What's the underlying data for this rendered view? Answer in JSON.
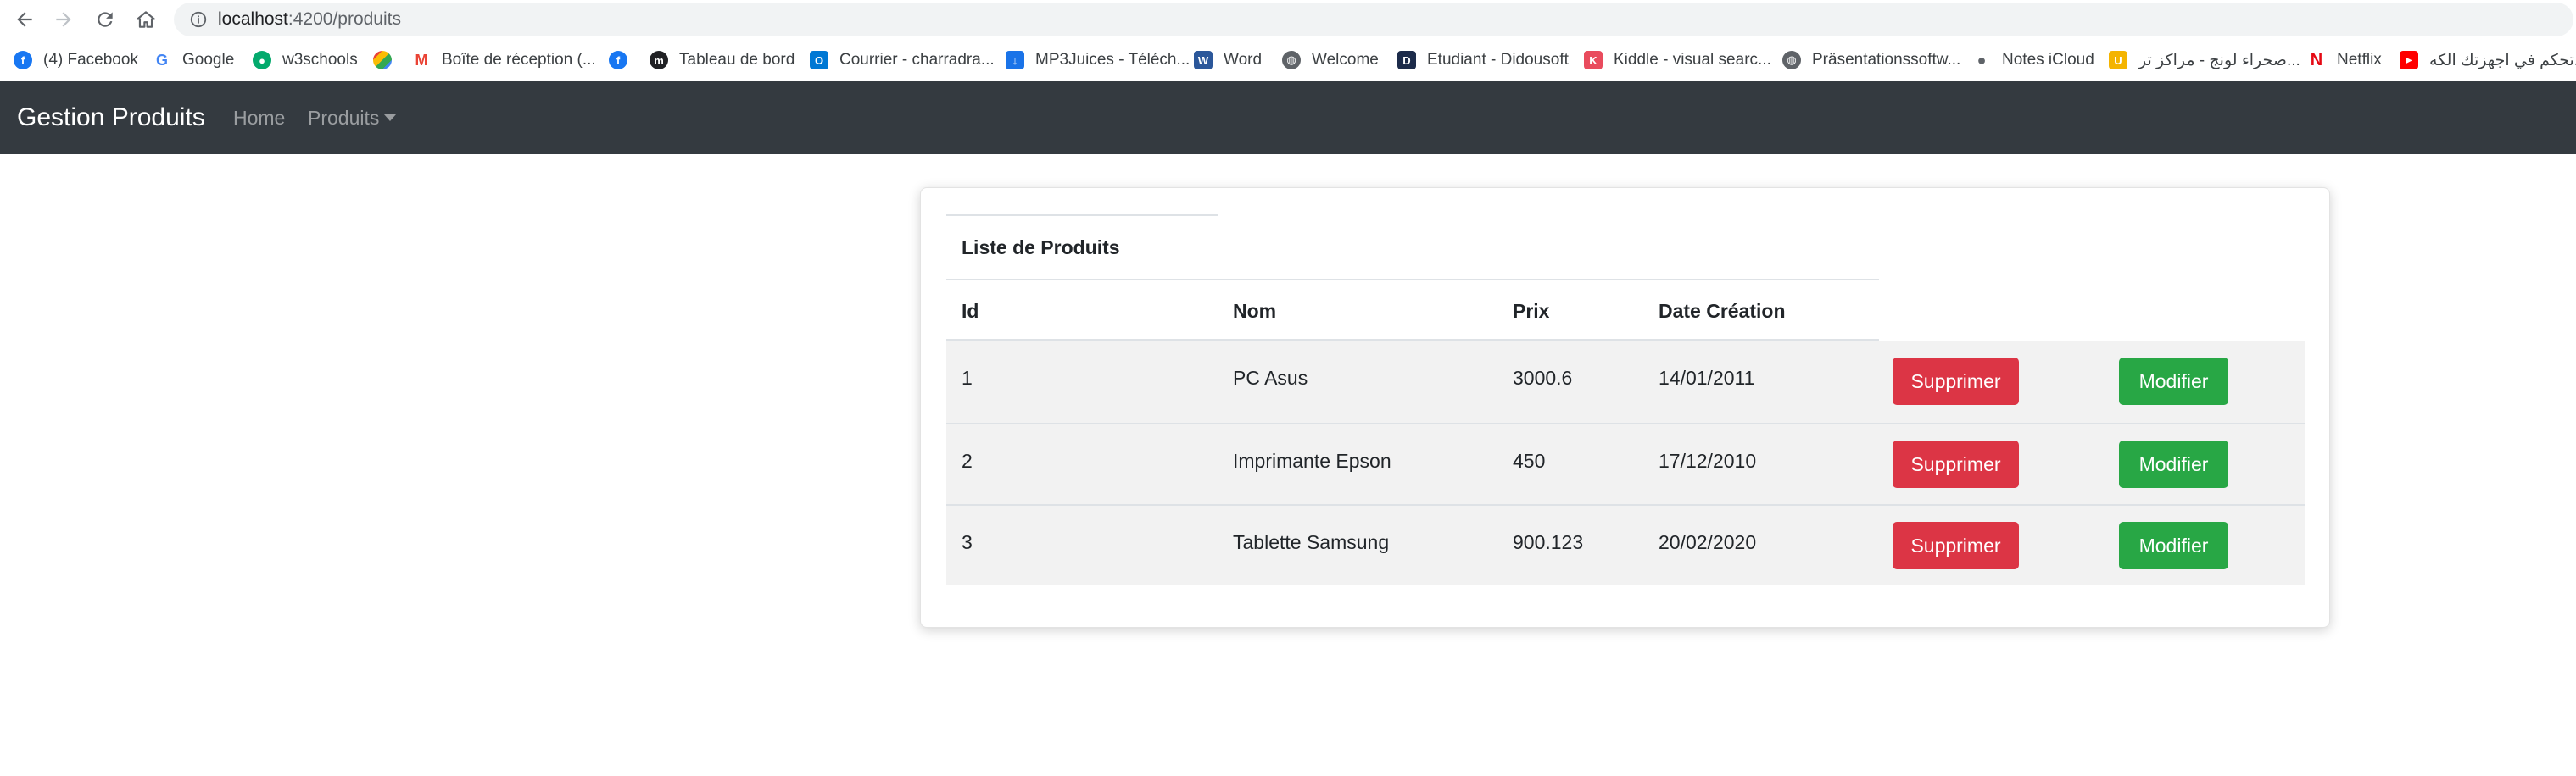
{
  "browser": {
    "url_host": "localhost",
    "url_path": ":4200/produits",
    "bookmarks": [
      {
        "label": "(4) Facebook",
        "icon": "facebook-icon",
        "color": "#1877f2"
      },
      {
        "label": "Google",
        "icon": "google-icon",
        "color": "#4285f4"
      },
      {
        "label": "w3schools",
        "icon": "w3schools-icon",
        "color": "#04aa6d"
      },
      {
        "label": "",
        "icon": "google-photos-icon",
        "color": "#fbbc04"
      },
      {
        "label": "Boîte de réception (...",
        "icon": "gmail-icon",
        "color": "#ea4335"
      },
      {
        "label": "",
        "icon": "facebook-icon",
        "color": "#1877f2"
      },
      {
        "label": "Tableau de bord",
        "icon": "moodle-icon",
        "color": "#202124"
      },
      {
        "label": "Courrier - charradra...",
        "icon": "outlook-icon",
        "color": "#0078d4"
      },
      {
        "label": "MP3Juices - Téléch...",
        "icon": "download-icon",
        "color": "#1a73e8"
      },
      {
        "label": "Word",
        "icon": "word-icon",
        "color": "#2b579a"
      },
      {
        "label": "Welcome",
        "icon": "globe-icon",
        "color": "#5f6368"
      },
      {
        "label": "Etudiant - Didousoft",
        "icon": "didousoft-icon",
        "color": "#1c2b4a"
      },
      {
        "label": "Kiddle - visual searc...",
        "icon": "kiddle-icon",
        "color": "#e94b5d"
      },
      {
        "label": "Präsentationssoftw...",
        "icon": "globe-icon",
        "color": "#5f6368"
      },
      {
        "label": "Notes iCloud",
        "icon": "apple-icon",
        "color": "#5f6368"
      },
      {
        "label": "صحراء لونج - مراكز تر...",
        "icon": "site-icon",
        "color": "#f4b400"
      },
      {
        "label": "Netflix",
        "icon": "netflix-icon",
        "color": "#e50914"
      },
      {
        "label": "تحكم في اجهزتك الكه...",
        "icon": "youtube-icon",
        "color": "#ff0000"
      }
    ]
  },
  "navbar": {
    "brand": "Gestion Produits",
    "home": "Home",
    "produits": "Produits"
  },
  "page": {
    "table_title": "Liste de Produits",
    "columns": [
      "Id",
      "Nom",
      "Prix",
      "Date Création"
    ],
    "rows": [
      {
        "id": "1",
        "nom": "PC Asus",
        "prix": "3000.6",
        "date": "14/01/2011"
      },
      {
        "id": "2",
        "nom": "Imprimante Epson",
        "prix": "450",
        "date": "17/12/2010"
      },
      {
        "id": "3",
        "nom": "Tablette Samsung",
        "prix": "900.123",
        "date": "20/02/2020"
      }
    ],
    "delete_label": "Supprimer",
    "edit_label": "Modifier"
  },
  "colors": {
    "navbar": "#343a40",
    "danger": "#dc3545",
    "success": "#28a745",
    "row_bg": "#f2f2f2"
  }
}
